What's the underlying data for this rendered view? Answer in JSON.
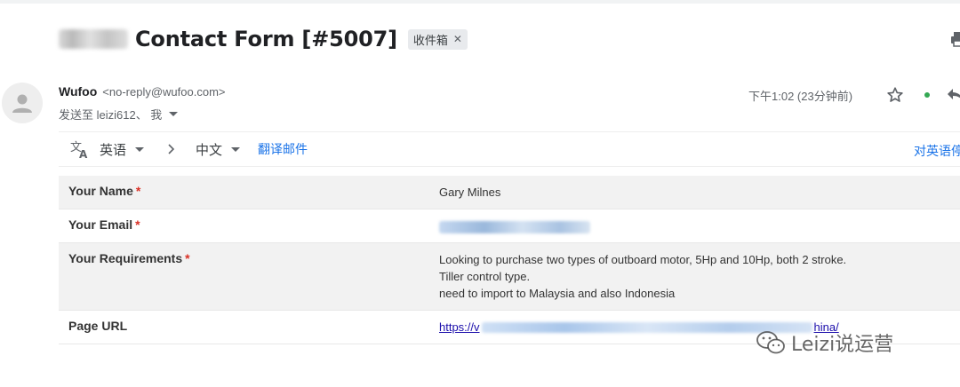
{
  "email": {
    "subject": "Contact Form [#5007]",
    "label_chip": "收件箱",
    "sender": {
      "name": "Wufoo",
      "address": "<no-reply@wufoo.com>",
      "recipients": "发送至 leizi612、 我"
    },
    "time": "下午1:02 (23分钟前)"
  },
  "translate": {
    "from_lang": "英语",
    "to_lang": "中文",
    "translate_link": "翻译邮件",
    "right_link": "对英语停"
  },
  "form": {
    "rows": [
      {
        "label": "Your Name",
        "required": "*",
        "value": "Gary Milnes"
      },
      {
        "label": "Your Email",
        "required": "*"
      },
      {
        "label": "Your Requirements",
        "required": "*",
        "value_lines": [
          "Looking to purchase two types of outboard motor, 5Hp and 10Hp, both 2 stroke.",
          "Tiller control type.",
          "need to import to Malaysia and also Indonesia"
        ]
      },
      {
        "label": "Page URL",
        "url_start": "https://v",
        "url_end": "hina/"
      }
    ]
  },
  "watermark": "Leizi说运营",
  "icons": {
    "avatar": "person-icon",
    "star": "star-icon",
    "reply": "reply-icon",
    "print": "print-icon",
    "translate": "translate-icon",
    "watermark": "wechat-icon"
  },
  "colors": {
    "link": "#1a73e8",
    "required": "#d93025",
    "row_shade": "#f2f2f2",
    "online_dot": "#34a853"
  }
}
